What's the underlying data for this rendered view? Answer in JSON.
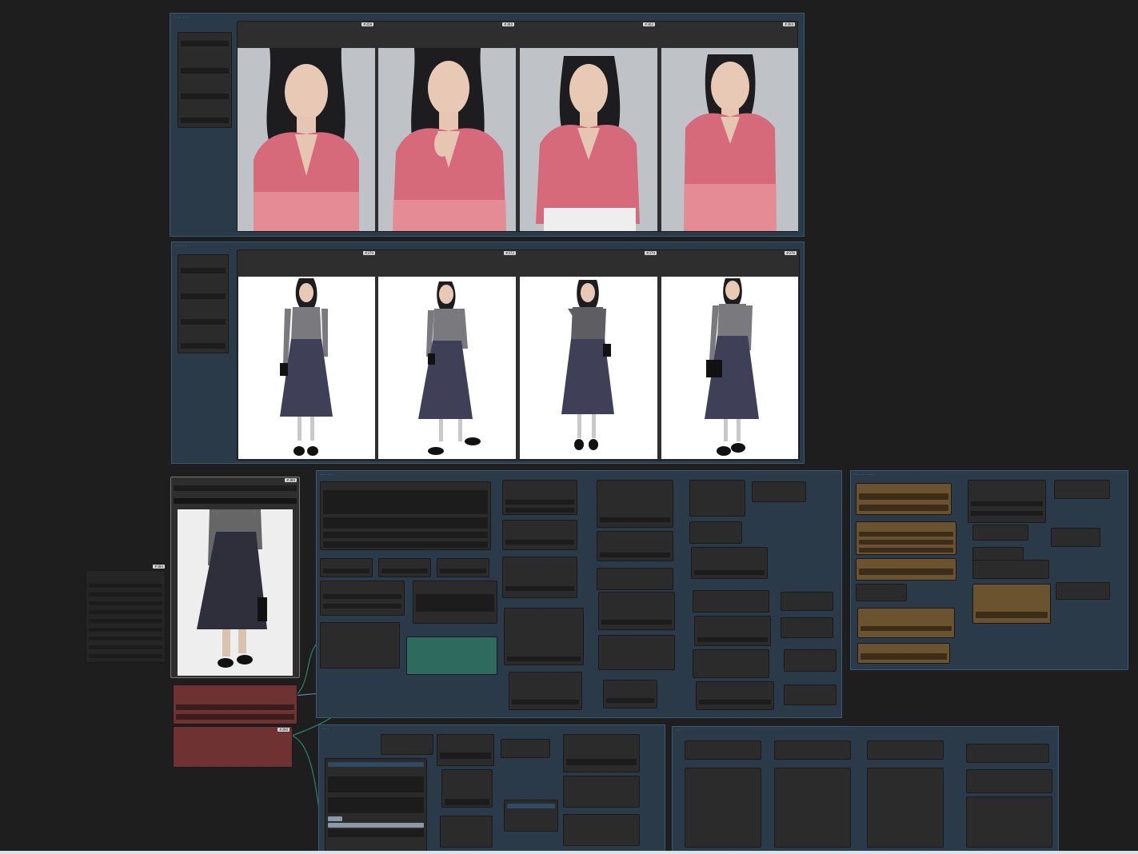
{
  "canvas": {
    "background": "#1e1e1e"
  },
  "groups": {
    "top_title": "·· ··· ·· ··",
    "middle_title": "·· ··· ·· ··",
    "center_title": "··· · ··· ·",
    "right_title": "···· ··· · ·····",
    "bottom_left_title": "··· ·",
    "bottom_right_title": "··· ·"
  },
  "badges": {
    "id_a": "#358",
    "id_b": "#360",
    "id_c": "#362",
    "id_d": "#364",
    "id_e": "#370",
    "id_f": "#372",
    "id_g": "#374",
    "id_h": "#376",
    "loader": "#380",
    "side": "#384",
    "mask": "#390"
  },
  "colors": {
    "group": "#2a3a48",
    "node": "#2b2b2b",
    "node_brown": "#6b5330",
    "node_red": "#6e3232",
    "node_teal": "#2e6a5e",
    "wire_blue": "#6aa0c8",
    "wire_green": "#2fa07a",
    "wire_yellow": "#d6b23a",
    "wire_pink": "#c79ad0"
  },
  "images": {
    "top_row": [
      "cardigan-portrait-1",
      "cardigan-portrait-2",
      "cardigan-portrait-3",
      "cardigan-portrait-4"
    ],
    "middle_row": [
      "fullbody-skirt-1",
      "fullbody-skirt-2",
      "fullbody-skirt-3",
      "fullbody-skirt-4"
    ],
    "reference": "skirt-reference"
  }
}
